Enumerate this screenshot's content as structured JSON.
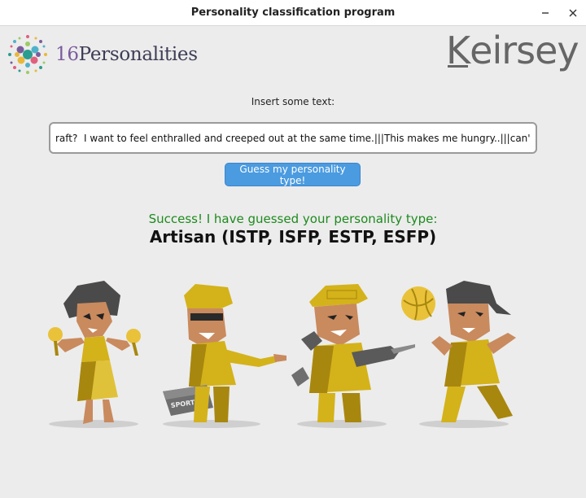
{
  "window": {
    "title": "Personality classification program",
    "minimize_glyph": "✕",
    "close_glyph": "✕"
  },
  "logos": {
    "sixteen_number": "16",
    "sixteen_name": "Personalities",
    "keirsey_first": "K",
    "keirsey_rest": "eirsey"
  },
  "form": {
    "label": "Insert some text:",
    "input_value": "raft?  I want to feel enthralled and creeped out at the same time.|||This makes me hungry..|||can't sleep",
    "button_label": "Guess my personality type!"
  },
  "result": {
    "success_text": "Success! I have guessed your personality type:",
    "type_text": "Artisan (ISTP, ISFP, ESTP, ESFP)"
  },
  "illustration": {
    "icons": [
      "dancer-with-maracas-icon",
      "pointing-man-with-sport-bag-icon",
      "worker-with-drill-icon",
      "woman-with-volleyball-icon"
    ],
    "label_on_bag": "SPORT",
    "colors": {
      "gold": "#d4b21a",
      "dark_gold": "#a8870f",
      "hair": "#4a4a4a",
      "skin": "#c98a5e",
      "shadow": "#cfcfcf"
    }
  }
}
